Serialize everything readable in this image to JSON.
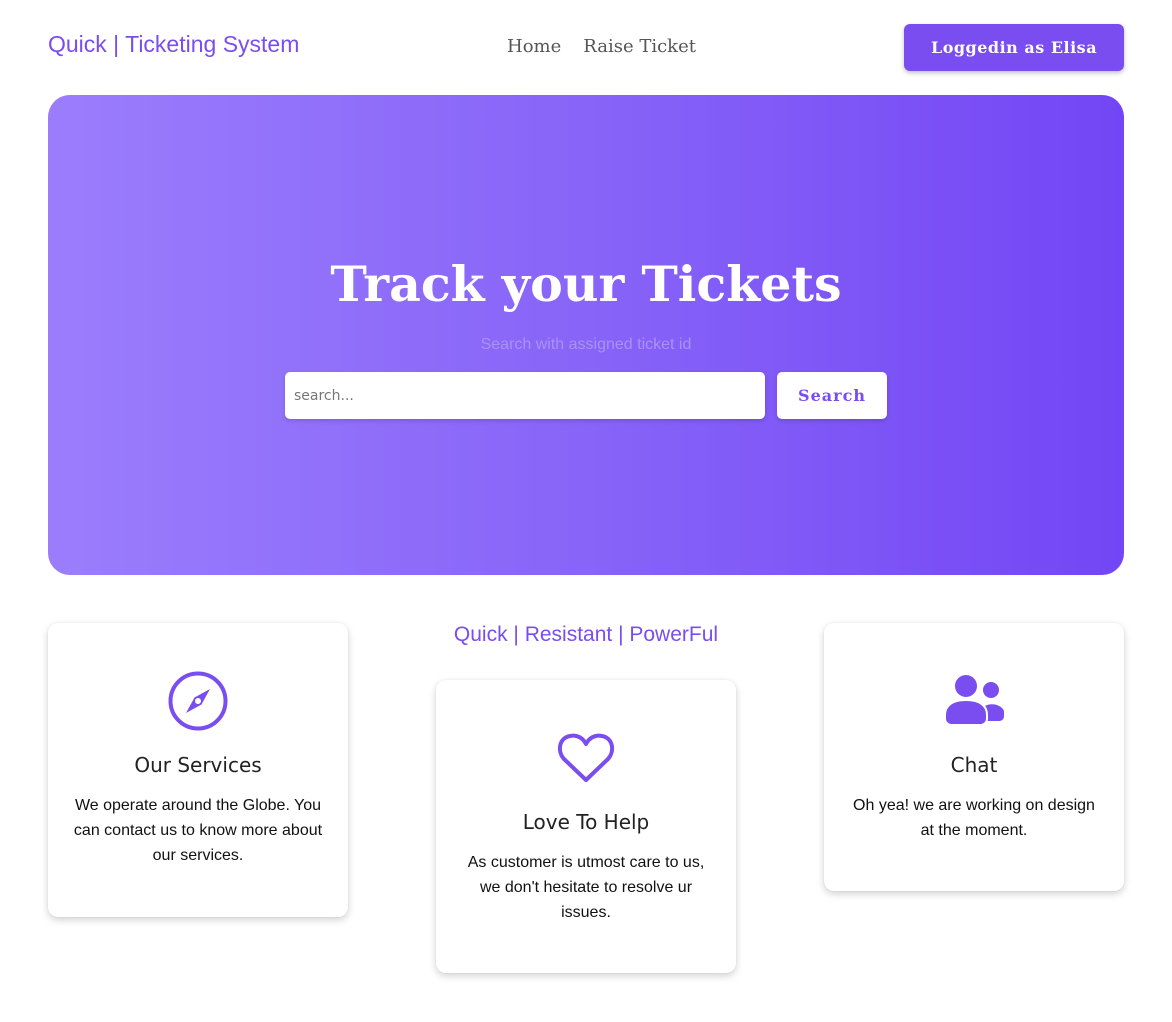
{
  "header": {
    "brand": "Quick | Ticketing System",
    "nav": [
      {
        "label": "Home"
      },
      {
        "label": "Raise Ticket"
      }
    ],
    "login_label": "Loggedin as Elisa"
  },
  "hero": {
    "title": "Track your Tickets",
    "subtitle": "Search with assigned ticket id",
    "search_placeholder": "search...",
    "search_button": "Search"
  },
  "features": {
    "tagline": "Quick | Resistant | PowerFul",
    "cards": [
      {
        "icon": "compass-icon",
        "title": "Our Services",
        "text": "We operate around the Globe. You can contact us to know more about our services."
      },
      {
        "icon": "heart-icon",
        "title": "Love To Help",
        "text": "As customer is utmost care to us, we don't hesitate to resolve ur issues."
      },
      {
        "icon": "users-icon",
        "title": "Chat",
        "text": "Oh yea! we are working on design at the moment."
      }
    ]
  },
  "colors": {
    "accent": "#7a4df0",
    "hero_gradient_start": "#9b7dfc",
    "hero_gradient_end": "#7346f5"
  }
}
